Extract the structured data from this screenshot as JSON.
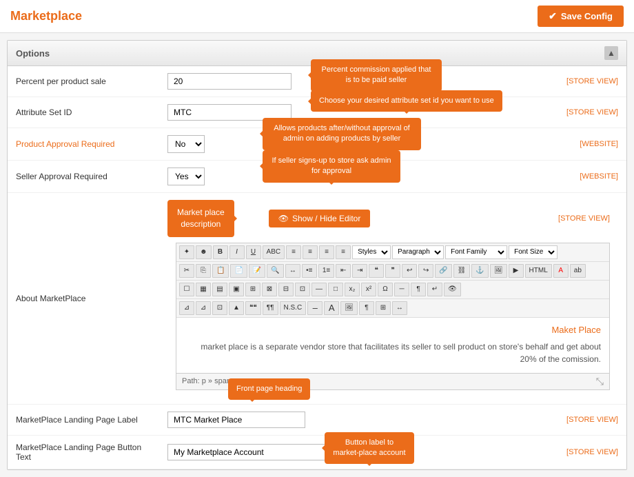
{
  "header": {
    "title": "Marketplace",
    "save_button": "Save Config"
  },
  "section": {
    "title": "Options",
    "toggle_icon": "▲"
  },
  "form": {
    "rows": [
      {
        "label": "Percent per product sale",
        "value": "20",
        "scope": "[STORE VIEW]",
        "tooltip": "Percent commission applied that is to be paid seller",
        "tooltip_arrow": "left"
      },
      {
        "label": "Attribute Set ID",
        "value": "MTC",
        "scope": "[STORE VIEW]",
        "tooltip": "Choose your desired attribute set id you want to use",
        "tooltip_arrow": "left"
      },
      {
        "label": "Product Approval Required",
        "value": "No",
        "scope": "[WEBSITE]",
        "tooltip": "Allows products after/without approval of admin on adding products by seller",
        "tooltip_arrow": "right",
        "label_orange": true
      },
      {
        "label": "Seller Approval Required",
        "value": "Yes",
        "scope": "[WEBSITE]",
        "tooltip": "If seller signs-up to store ask admin for approval",
        "tooltip_arrow": "right"
      },
      {
        "label": "About MarketPlace",
        "is_editor": true,
        "scope": "[STORE VIEW]"
      }
    ]
  },
  "editor": {
    "show_hide_label": "Show / Hide Editor",
    "toolbar_row1": [
      "✦",
      "☻",
      "B",
      "I",
      "U",
      "ABC",
      "≡",
      "≡",
      "≡",
      "≡"
    ],
    "styles_select": "Styles",
    "paragraph_select": "Paragraph",
    "font_family_label": "Font Family",
    "font_size_label": "Font Size",
    "heading_text": "Maket Place",
    "body_text": "market place is a separate vendor store that facilitates its seller to sell product on store's behalf and get about 20% of the comission.",
    "path_text": "Path: p » span"
  },
  "marketplace_callout": "Market place description",
  "landing_page_rows": [
    {
      "label": "MarketPlace Landing Page Label",
      "value": "MTC Market Place",
      "scope": "[STORE VIEW]",
      "tooltip": "Front page heading",
      "tooltip_arrow": "bottom-left"
    },
    {
      "label": "MarketPlace Landing Page Button Text",
      "value": "My Marketplace Account",
      "scope": "[STORE VIEW]",
      "tooltip": "Button label to market-place account",
      "tooltip_arrow": "top"
    }
  ]
}
